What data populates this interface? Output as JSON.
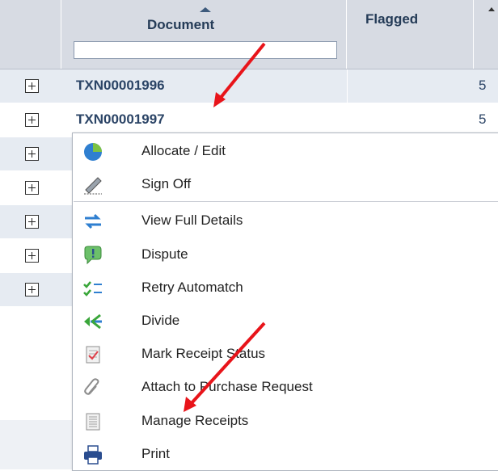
{
  "grid": {
    "columns": {
      "document": "Document",
      "flagged": "Flagged"
    },
    "filter": {
      "value": "",
      "placeholder": ""
    },
    "rows": [
      {
        "document": "TXN00001996",
        "next_col": "5"
      },
      {
        "document": "TXN00001997",
        "next_col": "5"
      }
    ]
  },
  "context_menu": {
    "items": [
      {
        "label": "Allocate / Edit",
        "icon": "pie-chart-icon"
      },
      {
        "label": "Sign Off",
        "icon": "pen-icon"
      },
      {
        "label": "View Full Details",
        "icon": "swap-arrows-icon"
      },
      {
        "label": "Dispute",
        "icon": "speech-bubble-icon"
      },
      {
        "label": "Retry Automatch",
        "icon": "checklist-icon"
      },
      {
        "label": "Divide",
        "icon": "split-arrows-icon"
      },
      {
        "label": "Mark Receipt Status",
        "icon": "receipt-check-icon"
      },
      {
        "label": "Attach to Purchase Request",
        "icon": "paperclip-icon"
      },
      {
        "label": "Manage Receipts",
        "icon": "receipt-icon"
      },
      {
        "label": "Print",
        "icon": "printer-icon"
      }
    ]
  },
  "colors": {
    "header_bg": "#d7dbe3",
    "row_alt_bg": "#e6ebf2",
    "link_text": "#2b4466",
    "annotation_arrow": "#e8141a"
  }
}
